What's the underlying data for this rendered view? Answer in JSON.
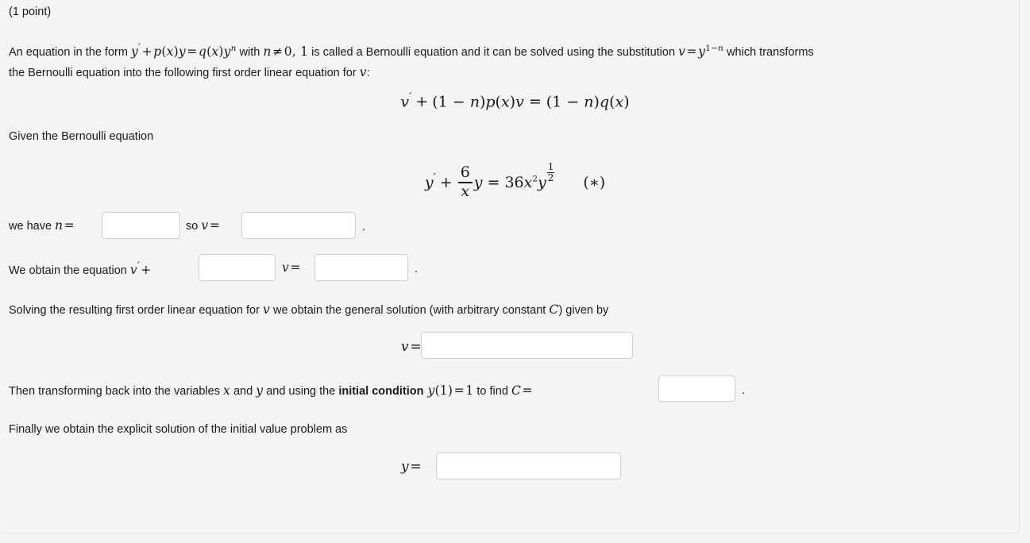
{
  "page": {
    "background_color": "#f4f4f4",
    "card_border_color": "#e2e2e2",
    "text_color": "#1a1a1a",
    "input_border_color": "#cfcfcf",
    "input_background": "#ffffff"
  },
  "header": {
    "points_label": "(1 point)"
  },
  "intro": {
    "line1_a": "An equation in the form ",
    "eq_inline_1": "y′ + p(x)y = q(x)y",
    "eq_inline_1_sup": "n",
    "line1_b": " with ",
    "eq_inline_2": "n ≠ 0, 1",
    "line1_c": " is called a Bernoulli equation and it can be solved using the substitution ",
    "eq_inline_3": "v = y",
    "eq_inline_3_sup": "1−n",
    "line1_d": " which transforms",
    "line2_a": "the Bernoulli equation into the following first order linear equation for ",
    "eq_inline_4": "v",
    "line2_b": ":"
  },
  "equations": {
    "linear_transform": "v′ + (1 − n)p(x)v = (1 − n)q(x)",
    "linear_transform_parts": {
      "v_prime": "v",
      "prime": "′",
      "plus": "+",
      "one_minus_n_1": "(1 − n)",
      "p_of_x": "p(x)",
      "v": "v",
      "equals": "=",
      "one_minus_n_2": "(1 − n)",
      "q_of_x": "q(x)"
    },
    "given_label": "Given the Bernoulli equation",
    "bernoulli": {
      "y_prime": "y",
      "prime": "′",
      "plus": "+",
      "frac_num": "6",
      "frac_den": "x",
      "y": "y",
      "equals": "=",
      "coefficient": "36",
      "x_var": "x",
      "x_exp": "2",
      "y_var": "y",
      "y_exp_num": "1",
      "y_exp_den": "2",
      "star": "(∗)"
    }
  },
  "fields": {
    "n_row": {
      "prefix": "we have ",
      "n_symbol": "n",
      "equals": "=",
      "input_n_value": "",
      "input_n_placeholder": "",
      "mid_text": "so ",
      "v_symbol": "v",
      "equals2": "=",
      "input_v_value": "",
      "input_v_placeholder": "",
      "period": "."
    },
    "equation_row": {
      "prefix": "We obtain the equation ",
      "v_symbol": "v",
      "prime": "′",
      "plus": "+",
      "input_coef_value": "",
      "input_coef_placeholder": "",
      "v_symbol_2": "v",
      "equals": "=",
      "input_rhs_value": "",
      "input_rhs_placeholder": "",
      "period": "."
    },
    "general_solution": {
      "text_a": "Solving the resulting first order linear equation for ",
      "v_symbol": "v",
      "text_b": " we obtain the general solution (with arbitrary constant ",
      "C_symbol": "C",
      "text_c": ") given by",
      "v_label": "v",
      "equals": "=",
      "input_v_general_value": "",
      "input_v_general_placeholder": ""
    },
    "initial_condition": {
      "text_a": "Then transforming back into the variables ",
      "x_symbol": "x",
      "text_b": " and ",
      "y_symbol": "y",
      "text_c": " and using the ",
      "bold_text": "initial condition",
      "condition": "y(1) = 1",
      "text_d": " to find ",
      "C_symbol": "C",
      "equals": "=",
      "input_C_value": "",
      "input_C_placeholder": "",
      "period": "."
    },
    "final_solution": {
      "text": "Finally we obtain the explicit solution of the initial value problem as",
      "y_label": "y",
      "equals": "=",
      "input_y_value": "",
      "input_y_placeholder": ""
    }
  }
}
